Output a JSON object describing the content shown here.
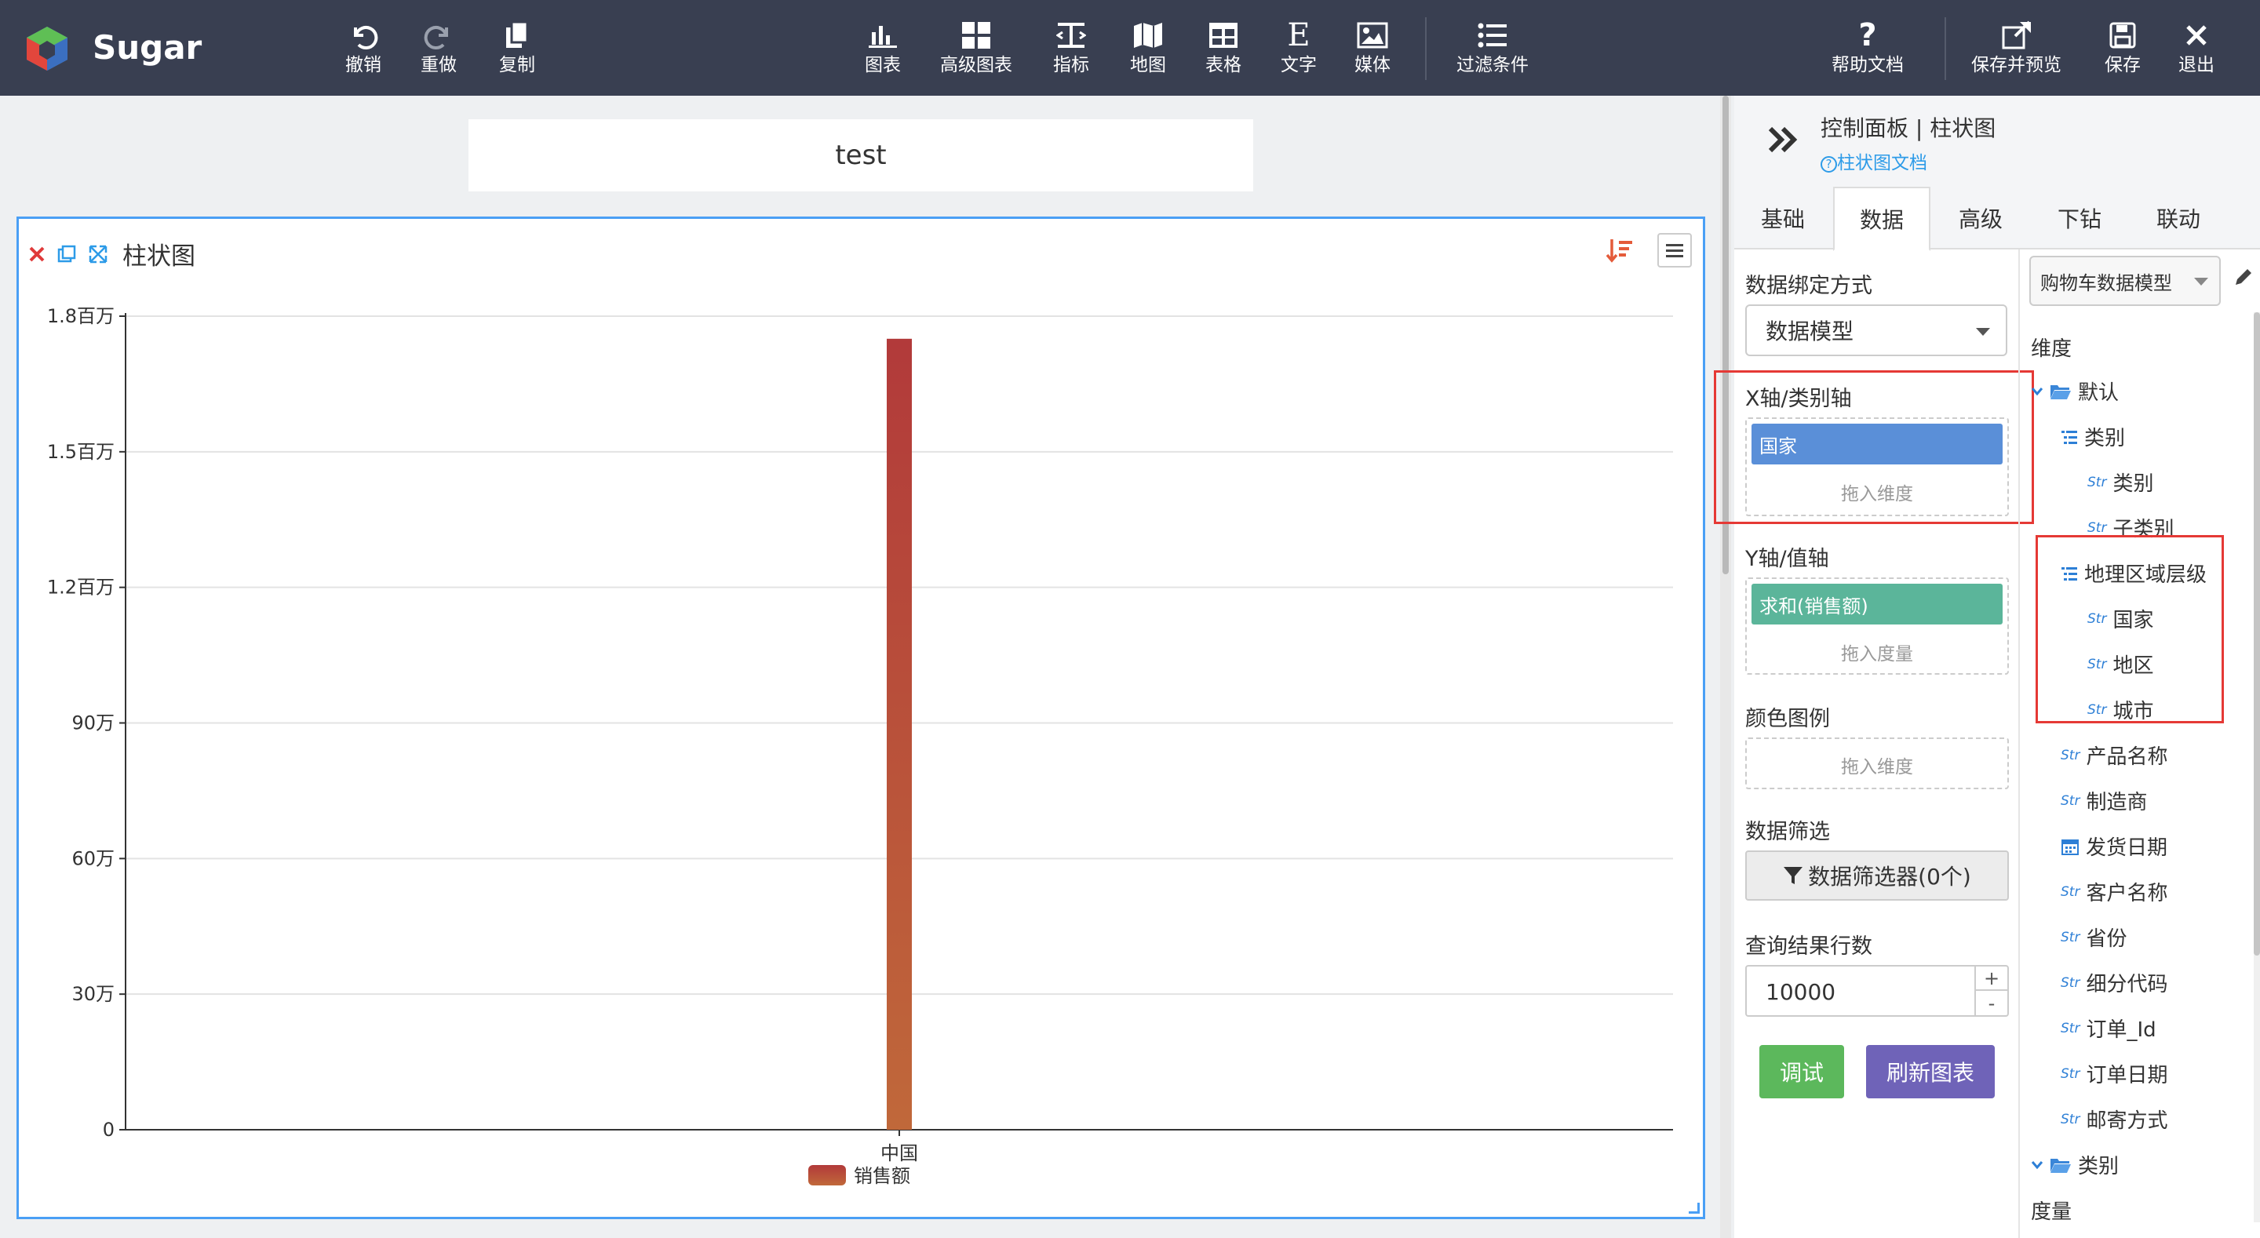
{
  "app": {
    "name": "Sugar"
  },
  "toolbar": {
    "undo": "撤销",
    "redo": "重做",
    "copy": "复制",
    "chart": "图表",
    "advanced_chart": "高级图表",
    "metric": "指标",
    "map": "地图",
    "table": "表格",
    "text": "文字",
    "media": "媒体",
    "filter": "过滤条件",
    "help": "帮助文档",
    "save_preview": "保存并预览",
    "save": "保存",
    "exit": "退出"
  },
  "dashboard": {
    "title": "test"
  },
  "widget": {
    "name": "柱状图"
  },
  "chart_data": {
    "type": "bar",
    "categories": [
      "中国"
    ],
    "series": [
      {
        "name": "销售额",
        "values": [
          1750000
        ]
      }
    ],
    "y_ticks": [
      "0",
      "30万",
      "60万",
      "90万",
      "1.2百万",
      "1.5百万",
      "1.8百万"
    ],
    "ylim": [
      0,
      1800000
    ],
    "legend_position": "bottom-center",
    "grid": true,
    "colors": {
      "bar_top": "#b23a3a",
      "bar_bottom": "#c0683a"
    }
  },
  "panel": {
    "title": "控制面板 | 柱状图",
    "doc_link": "柱状图文档",
    "tabs": [
      "基础",
      "数据",
      "高级",
      "下钻",
      "联动"
    ],
    "active_tab": "数据",
    "binding_label": "数据绑定方式",
    "binding_value": "数据模型",
    "x_axis_label": "X轴/类别轴",
    "x_axis_chip": "国家",
    "x_axis_hint": "拖入维度",
    "y_axis_label": "Y轴/值轴",
    "y_axis_chip": "求和(销售额)",
    "y_axis_hint": "拖入度量",
    "color_label": "颜色图例",
    "color_hint": "拖入维度",
    "filter_label": "数据筛选",
    "filter_button": "数据筛选器(0个)",
    "rows_label": "查询结果行数",
    "rows_value": "10000",
    "debug_button": "调试",
    "refresh_button": "刷新图表",
    "model_select": "购物车数据模型",
    "dimension_header": "维度",
    "measure_header": "度量",
    "str_tag": "Str",
    "tree": {
      "folder_default": "默认",
      "group_category": "类别",
      "category": "类别",
      "subcategory": "子类别",
      "group_geo": "地理区域层级",
      "country": "国家",
      "region": "地区",
      "city": "城市",
      "product": "产品名称",
      "maker": "制造商",
      "ship_date": "发货日期",
      "customer": "客户名称",
      "province": "省份",
      "segment_code": "细分代码",
      "order_id": "订单_Id",
      "order_date": "订单日期",
      "ship_mode": "邮寄方式",
      "folder_category": "类别"
    }
  },
  "colors": {
    "topbar": "#393f51",
    "accent": "#4a9ff5",
    "chip_blue": "#5a8fd8",
    "chip_green": "#5bb59a",
    "debug_green": "#5cb85c",
    "refresh_purple": "#6f63b8",
    "highlight_red": "#e53935"
  }
}
